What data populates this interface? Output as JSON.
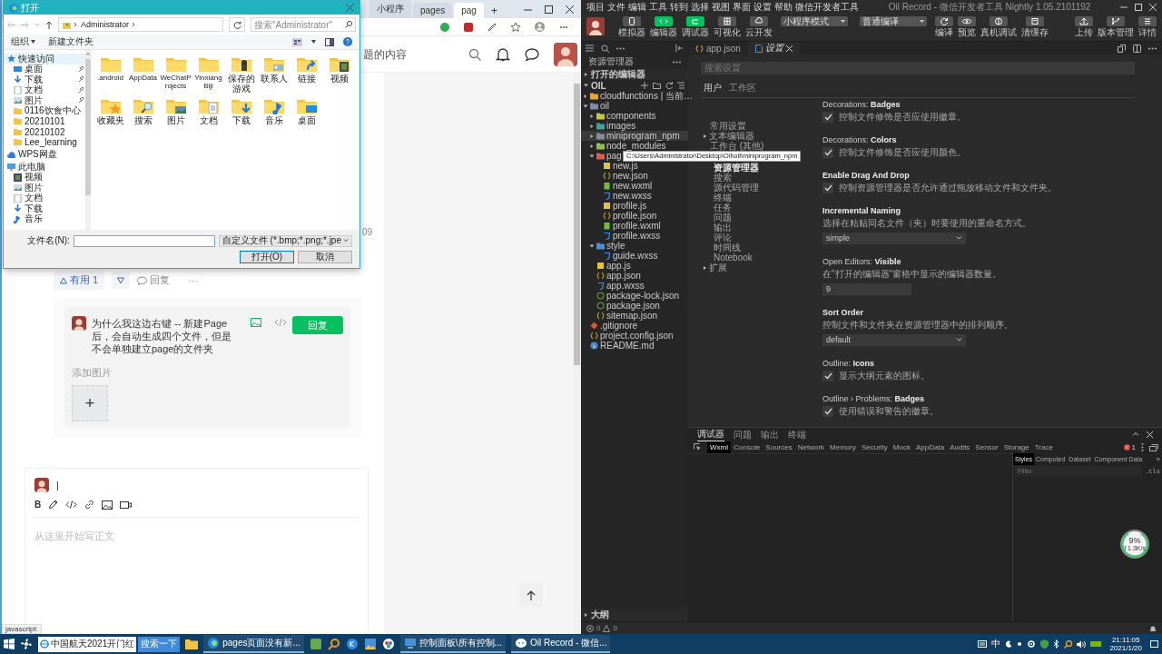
{
  "browser": {
    "tabs": [
      {
        "label": "小程序",
        "selected": false
      },
      {
        "label": "pages",
        "selected": false
      },
      {
        "label": "pag",
        "selected": true
      }
    ],
    "new_tab": "+",
    "search": {
      "placeholder": "题的内容"
    },
    "comment_date": "09",
    "actions": {
      "useful": "有用 1",
      "reply": "回复",
      "more": "···"
    },
    "reply_box": {
      "text": "为什么我这边右键 -- 新建Page后，会自动生成四个文件，但是不会单独建立page的文件夹",
      "submit": "回复",
      "add_image": "添加图片",
      "add": "+"
    },
    "editor": {
      "cursor": "|",
      "bold": "B",
      "placeholder": "从这里开始写正文"
    },
    "status": "javascript:"
  },
  "file_dialog": {
    "title": "打开",
    "path": "Administrator",
    "search": {
      "placeholder": "搜索\"Administrator\""
    },
    "organize": "组织",
    "new_folder": "新建文件夹",
    "nav": [
      {
        "label": "快速访问",
        "kind": "star",
        "selected": true,
        "children": [
          {
            "label": "桌面",
            "kind": "desktop",
            "pinned": true,
            "selected": false
          },
          {
            "label": "下载",
            "kind": "download",
            "pinned": true,
            "selected": false
          },
          {
            "label": "文档",
            "kind": "document",
            "pinned": true,
            "selected": false
          },
          {
            "label": "图片",
            "kind": "picture",
            "pinned": true,
            "selected": false
          },
          {
            "label": "0116饮食中心",
            "kind": "folder",
            "pinned": false,
            "selected": false
          },
          {
            "label": "20210101",
            "kind": "folder",
            "pinned": false,
            "selected": false
          },
          {
            "label": "20210102",
            "kind": "folder",
            "pinned": false,
            "selected": false
          },
          {
            "label": "Lee_learning",
            "kind": "folder",
            "pinned": false,
            "selected": false
          }
        ]
      },
      {
        "label": "WPS网盘",
        "kind": "cloud",
        "selected": false
      },
      {
        "label": "此电脑",
        "kind": "computer",
        "selected": false,
        "children": [
          {
            "label": "视频",
            "kind": "video",
            "pinned": false,
            "selected": false
          },
          {
            "label": "图片",
            "kind": "picture",
            "pinned": false,
            "selected": false
          },
          {
            "label": "文档",
            "kind": "document",
            "pinned": false,
            "selected": false
          },
          {
            "label": "下载",
            "kind": "download",
            "pinned": false,
            "selected": false
          },
          {
            "label": "音乐",
            "kind": "music",
            "pinned": false,
            "selected": false
          }
        ]
      }
    ],
    "files": [
      {
        "label": ".android",
        "kind": "folder"
      },
      {
        "label": "AppData",
        "kind": "folder"
      },
      {
        "label": "WeChatProjects",
        "kind": "folder"
      },
      {
        "label": "YinxiangBiji",
        "kind": "folder"
      },
      {
        "label": "保存的游戏",
        "kind": "game"
      },
      {
        "label": "联系人",
        "kind": "contacts"
      },
      {
        "label": "链接",
        "kind": "link"
      },
      {
        "label": "视频",
        "kind": "video"
      },
      {
        "label": "收藏夹",
        "kind": "star"
      },
      {
        "label": "搜索",
        "kind": "search"
      },
      {
        "label": "图片",
        "kind": "picture"
      },
      {
        "label": "文档",
        "kind": "document"
      },
      {
        "label": "下载",
        "kind": "download"
      },
      {
        "label": "音乐",
        "kind": "music"
      },
      {
        "label": "桌面",
        "kind": "desktop"
      }
    ],
    "filename_label": "文件名(N):",
    "filetype": "自定义文件 (*.bmp;*.png;*.jpe",
    "buttons": [
      {
        "label": "打开(O)",
        "default": true
      },
      {
        "label": "取消",
        "default": false
      }
    ]
  },
  "ide": {
    "menu": [
      "项目",
      "文件",
      "编辑",
      "工具",
      "转到",
      "选择",
      "视图",
      "界面",
      "设置",
      "帮助",
      "微信开发者工具"
    ],
    "title": "Oil Record - 微信开发者工具 Nightly 1.05.2101192",
    "modes": [
      {
        "label": "模拟器",
        "on": false
      },
      {
        "label": "编辑器",
        "on": true
      },
      {
        "label": "调试器",
        "on": true
      },
      {
        "label": "可视化",
        "on": false
      },
      {
        "label": "云开发",
        "on": false
      }
    ],
    "mode_select": "小程序模式",
    "compile_select": "普通编译",
    "actions": [
      "编译",
      "预览",
      "真机调试",
      "清缓存"
    ],
    "right_actions": [
      "上传",
      "版本管理",
      "详情"
    ],
    "editor_tabs": [
      {
        "label": "app.json",
        "selected": false
      },
      {
        "label": "设置",
        "selected": true
      }
    ],
    "explorer": {
      "title": "资源管理器",
      "open_editors": "打开的编辑器",
      "project": "OIL",
      "tree": [
        {
          "label": "cloudfunctions | 当前…",
          "kind": "folder",
          "color": "#e8a33c",
          "expanded": false,
          "selected": false
        },
        {
          "label": "oil",
          "kind": "folder",
          "color": "#7a8ea8",
          "expanded": true,
          "selected": false,
          "children": [
            {
              "label": "components",
              "kind": "folder",
              "color": "#c9c43a",
              "expanded": false,
              "selected": false
            },
            {
              "label": "images",
              "kind": "folder",
              "color": "#3aa6a0",
              "expanded": false,
              "selected": false
            },
            {
              "label": "miniprogram_npm",
              "kind": "folder",
              "color": "#8a8f96",
              "expanded": false,
              "selected": true
            },
            {
              "label": "node_modules",
              "kind": "folder",
              "color": "#8bc34a",
              "expanded": false,
              "selected": false
            },
            {
              "label": "pag",
              "kind": "folder",
              "color": "#e25b4b",
              "expanded": true,
              "selected": false,
              "children": [
                {
                  "label": "new.js",
                  "kind": "js",
                  "selected": false
                },
                {
                  "label": "new.json",
                  "kind": "json",
                  "selected": false
                },
                {
                  "label": "new.wxml",
                  "kind": "wxml",
                  "selected": false
                },
                {
                  "label": "new.wxss",
                  "kind": "wxss",
                  "selected": false
                },
                {
                  "label": "profile.js",
                  "kind": "js",
                  "selected": false
                },
                {
                  "label": "profile.json",
                  "kind": "json",
                  "selected": false
                },
                {
                  "label": "profile.wxml",
                  "kind": "wxml",
                  "selected": false
                },
                {
                  "label": "profile.wxss",
                  "kind": "wxss",
                  "selected": false
                }
              ]
            },
            {
              "label": "style",
              "kind": "folder",
              "color": "#4a90d9",
              "expanded": true,
              "selected": false,
              "children": [
                {
                  "label": "guide.wxss",
                  "kind": "wxss",
                  "selected": false
                }
              ]
            },
            {
              "label": "app.js",
              "kind": "js",
              "selected": false
            },
            {
              "label": "app.json",
              "kind": "json",
              "selected": false
            },
            {
              "label": "app.wxss",
              "kind": "wxss",
              "selected": false
            },
            {
              "label": "package-lock.json",
              "kind": "npm",
              "selected": false
            },
            {
              "label": "package.json",
              "kind": "npm",
              "selected": false
            },
            {
              "label": "sitemap.json",
              "kind": "json",
              "selected": false
            }
          ]
        },
        {
          "label": ".gitignore",
          "kind": "git",
          "selected": false
        },
        {
          "label": "project.config.json",
          "kind": "json",
          "selected": false
        },
        {
          "label": "README.md",
          "kind": "info",
          "selected": false
        }
      ],
      "tooltip": "C:\\Users\\Administrator\\Desktop\\Oil\\oil\\miniprogram_npm"
    },
    "settings": {
      "search": {
        "placeholder": "搜索设置"
      },
      "scopes": [
        {
          "label": "用户",
          "selected": true
        },
        {
          "label": "工作区",
          "selected": false
        }
      ],
      "nav": [
        {
          "label": "常用设置",
          "selected": false
        },
        {
          "label": "文本编辑器",
          "expanded": false,
          "selected": false
        },
        {
          "label": "工作台 (其他)",
          "selected": false
        },
        {
          "label": "资源管理器",
          "selected": true,
          "sub": true
        },
        {
          "label": "搜索",
          "selected": false,
          "sub": true
        },
        {
          "label": "源代码管理",
          "selected": false,
          "sub": true
        },
        {
          "label": "终端",
          "selected": false,
          "sub": true
        },
        {
          "label": "任务",
          "selected": false,
          "sub": true
        },
        {
          "label": "问题",
          "selected": false,
          "sub": true
        },
        {
          "label": "输出",
          "selected": false,
          "sub": true
        },
        {
          "label": "评论",
          "selected": false,
          "sub": true
        },
        {
          "label": "时间线",
          "selected": false,
          "sub": true
        },
        {
          "label": "Notebook",
          "selected": false,
          "sub": true
        },
        {
          "label": "扩展",
          "expanded": false,
          "selected": false
        }
      ],
      "entries": [
        {
          "kind": "checkbox",
          "category": "Decorations: ",
          "name": "Badges",
          "description": "控制文件修饰是否应使用徽章。",
          "checked": true
        },
        {
          "kind": "checkbox",
          "category": "Decorations: ",
          "name": "Colors",
          "description": "控制文件修饰是否应使用颜色。",
          "checked": true
        },
        {
          "kind": "checkbox",
          "name": "Enable Drag And Drop",
          "description": "控制资源管理器是否允许通过拖放移动文件和文件夹。",
          "checked": true
        },
        {
          "kind": "select",
          "name": "Incremental Naming",
          "description": "选择在粘贴同名文件（夹）时要使用的重命名方式。",
          "value": "simple"
        },
        {
          "kind": "number",
          "category": "Open Editors: ",
          "name": "Visible",
          "description": "在\"打开的编辑器\"窗格中显示的编辑器数量。",
          "value": "9"
        },
        {
          "kind": "select",
          "name": "Sort Order",
          "description": "控制文件和文件夹在资源管理器中的排列顺序。",
          "value": "default"
        },
        {
          "kind": "checkbox",
          "category": "Outline: ",
          "name": "Icons",
          "description": "显示大纲元素的图标。",
          "checked": true
        },
        {
          "kind": "checkbox",
          "category": "Outline › Problems: ",
          "name": "Badges",
          "description": "使用错误和警告的徽章。",
          "checked": true
        }
      ]
    },
    "panel": {
      "tabs": [
        {
          "label": "调试器",
          "selected": true
        },
        {
          "label": "问题",
          "selected": false
        },
        {
          "label": "输出",
          "selected": false
        },
        {
          "label": "终端",
          "selected": false
        }
      ],
      "devtools_tabs": [
        {
          "label": "Wxml",
          "selected": true
        },
        {
          "label": "Console",
          "selected": false
        },
        {
          "label": "Sources",
          "selected": false
        },
        {
          "label": "Network",
          "selected": false
        },
        {
          "label": "Memory",
          "selected": false
        },
        {
          "label": "Security",
          "selected": false
        },
        {
          "label": "Mock",
          "selected": false
        },
        {
          "label": "AppData",
          "selected": false
        },
        {
          "label": "Audits",
          "selected": false
        },
        {
          "label": "Sensor",
          "selected": false
        },
        {
          "label": "Storage",
          "selected": false
        },
        {
          "label": "Trace",
          "selected": false
        }
      ],
      "error_count": "1",
      "side_tabs": [
        {
          "label": "Styles",
          "selected": true
        },
        {
          "label": "Computed",
          "selected": false
        },
        {
          "label": "Dataset",
          "selected": false
        },
        {
          "label": "Component Data",
          "selected": false
        }
      ],
      "more": "»",
      "filter": {
        "placeholder": "Filter"
      },
      "cls": ".cls"
    },
    "outline": "大纲",
    "status": {
      "errors": "0",
      "warnings": "0"
    }
  },
  "net_widget": {
    "percent": "9%",
    "speed": "1.3K/s"
  },
  "taskbar": {
    "search": "中国航天2021开门红",
    "search_button": "搜索一下",
    "windows": [
      "pages页面没有新...",
      "控制面板\\所有控制...",
      "Oil Record - 微信..."
    ],
    "ime": "中",
    "time": "21:11:05",
    "date": "2021/1/20"
  }
}
